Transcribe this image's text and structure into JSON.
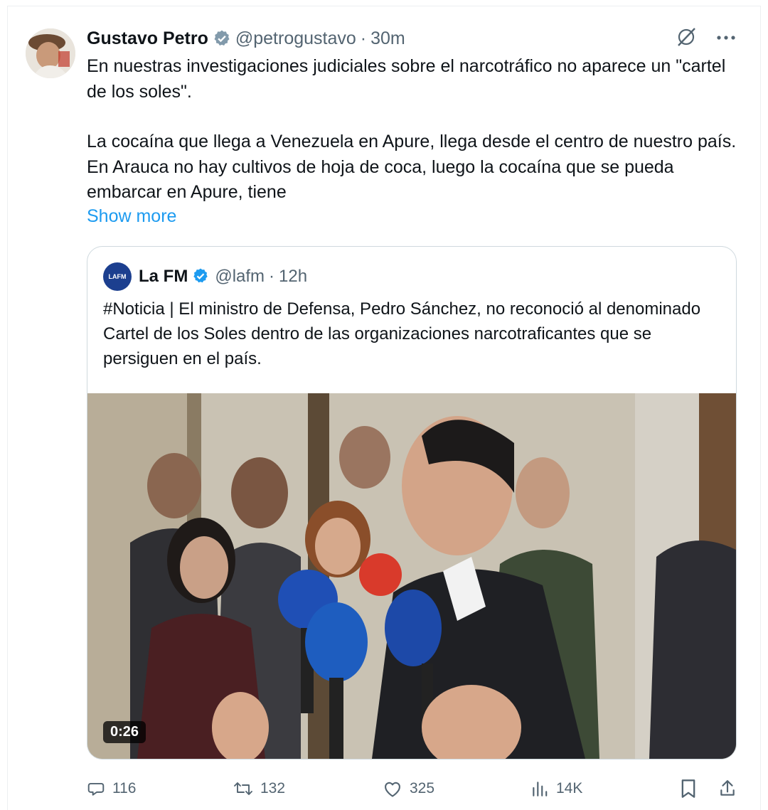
{
  "tweet": {
    "author_name": "Gustavo Petro",
    "handle": "@petrogustavo",
    "separator": "·",
    "time": "30m",
    "text_paragraphs": [
      "En nuestras investigaciones judiciales sobre el narcotráfico no aparece un \"cartel de los soles\".",
      "La cocaína que llega a Venezuela en Apure, llega desde el centro de nuestro país. En Arauca no hay cultivos de hoja de coca, luego la cocaína que se pueda embarcar en Apure, tiene"
    ],
    "show_more": "Show more"
  },
  "quote": {
    "avatar_text": "LAFM",
    "author_name": "La FM",
    "handle": "@lafm",
    "separator": "·",
    "time": "12h",
    "text": "#Noticia | El ministro de Defensa, Pedro Sánchez, no reconoció al denominado Cartel de los Soles dentro de las organizaciones narcotraficantes que se persiguen en el país.",
    "video_duration": "0:26"
  },
  "actions": {
    "replies": "116",
    "reposts": "132",
    "likes": "325",
    "views": "14K"
  },
  "icons": {
    "verified": "verified-badge-icon",
    "grok": "grok-icon",
    "more": "more-icon",
    "reply": "reply-icon",
    "repost": "repost-icon",
    "like": "heart-icon",
    "views": "views-icon",
    "bookmark": "bookmark-icon",
    "share": "share-icon"
  },
  "colors": {
    "accent": "#1d9bf0",
    "text": "#0f1419",
    "muted": "#536471",
    "border": "#cfd9de"
  }
}
